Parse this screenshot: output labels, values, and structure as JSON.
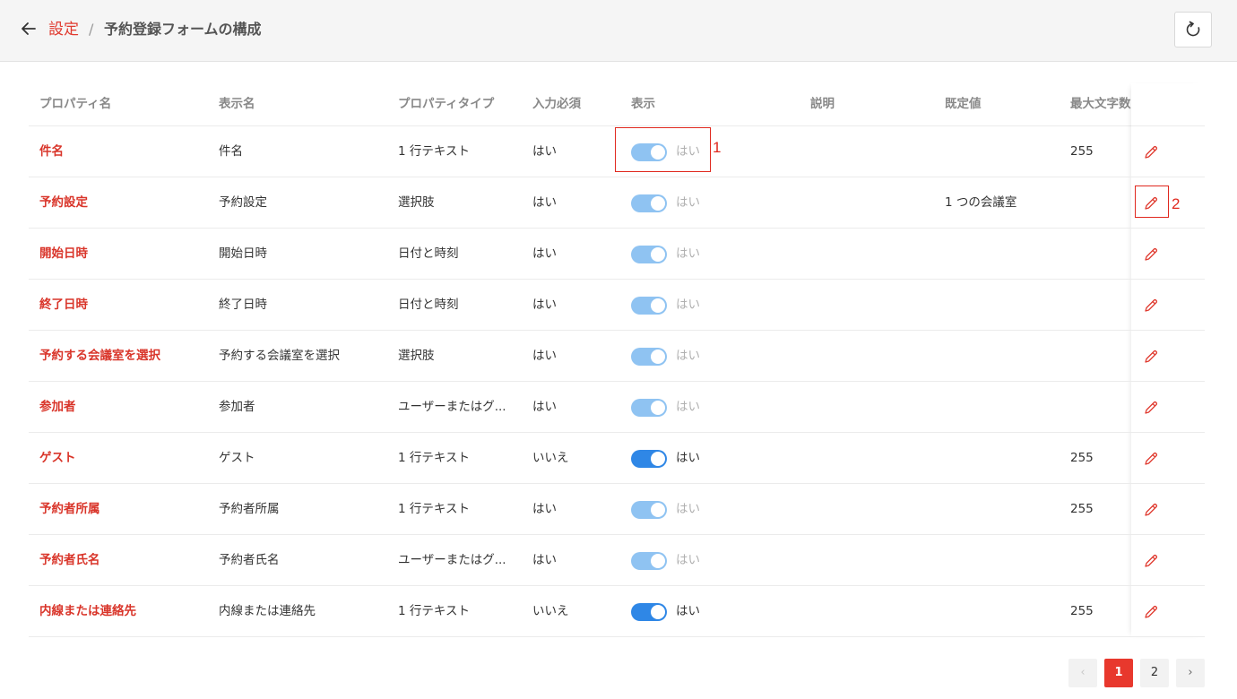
{
  "header": {
    "breadcrumb_link": "設定",
    "separator": "/",
    "title": "予約登録フォームの構成"
  },
  "columns": {
    "prop": "プロパティ名",
    "disp": "表示名",
    "type": "プロパティタイプ",
    "req": "入力必須",
    "vis": "表示",
    "desc": "説明",
    "def": "既定値",
    "max": "最大文字数"
  },
  "rows": [
    {
      "prop": "件名",
      "disp": "件名",
      "type": "1 行テキスト",
      "req": "はい",
      "vis_label": "はい",
      "vis_state": "locked",
      "desc": "",
      "def": "",
      "max": "255"
    },
    {
      "prop": "予約設定",
      "disp": "予約設定",
      "type": "選択肢",
      "req": "はい",
      "vis_label": "はい",
      "vis_state": "locked",
      "desc": "",
      "def": "1 つの会議室",
      "max": ""
    },
    {
      "prop": "開始日時",
      "disp": "開始日時",
      "type": "日付と時刻",
      "req": "はい",
      "vis_label": "はい",
      "vis_state": "locked",
      "desc": "",
      "def": "",
      "max": ""
    },
    {
      "prop": "終了日時",
      "disp": "終了日時",
      "type": "日付と時刻",
      "req": "はい",
      "vis_label": "はい",
      "vis_state": "locked",
      "desc": "",
      "def": "",
      "max": ""
    },
    {
      "prop": "予約する会議室を選択",
      "disp": "予約する会議室を選択",
      "type": "選択肢",
      "req": "はい",
      "vis_label": "はい",
      "vis_state": "locked",
      "desc": "",
      "def": "",
      "max": ""
    },
    {
      "prop": "参加者",
      "disp": "参加者",
      "type": "ユーザーまたはグ...",
      "req": "はい",
      "vis_label": "はい",
      "vis_state": "locked",
      "desc": "",
      "def": "",
      "max": ""
    },
    {
      "prop": "ゲスト",
      "disp": "ゲスト",
      "type": "1 行テキスト",
      "req": "いいえ",
      "vis_label": "はい",
      "vis_state": "on",
      "desc": "",
      "def": "",
      "max": "255"
    },
    {
      "prop": "予約者所属",
      "disp": "予約者所属",
      "type": "1 行テキスト",
      "req": "はい",
      "vis_label": "はい",
      "vis_state": "locked",
      "desc": "",
      "def": "",
      "max": "255"
    },
    {
      "prop": "予約者氏名",
      "disp": "予約者氏名",
      "type": "ユーザーまたはグ...",
      "req": "はい",
      "vis_label": "はい",
      "vis_state": "locked",
      "desc": "",
      "def": "",
      "max": ""
    },
    {
      "prop": "内線または連絡先",
      "disp": "内線または連絡先",
      "type": "1 行テキスト",
      "req": "いいえ",
      "vis_label": "はい",
      "vis_state": "on",
      "desc": "",
      "def": "",
      "max": "255"
    }
  ],
  "annotations": {
    "one": "1",
    "two": "2"
  },
  "pagination": {
    "prev": "‹",
    "pages": [
      "1",
      "2"
    ],
    "current": "1",
    "next": "›"
  },
  "colors": {
    "accent": "#e03a2f",
    "toggle_on": "#2f87e6",
    "toggle_locked": "#8fc3f2"
  },
  "icons": {
    "back": "arrow-left-icon",
    "refresh": "refresh-icon",
    "edit": "pencil-icon"
  }
}
